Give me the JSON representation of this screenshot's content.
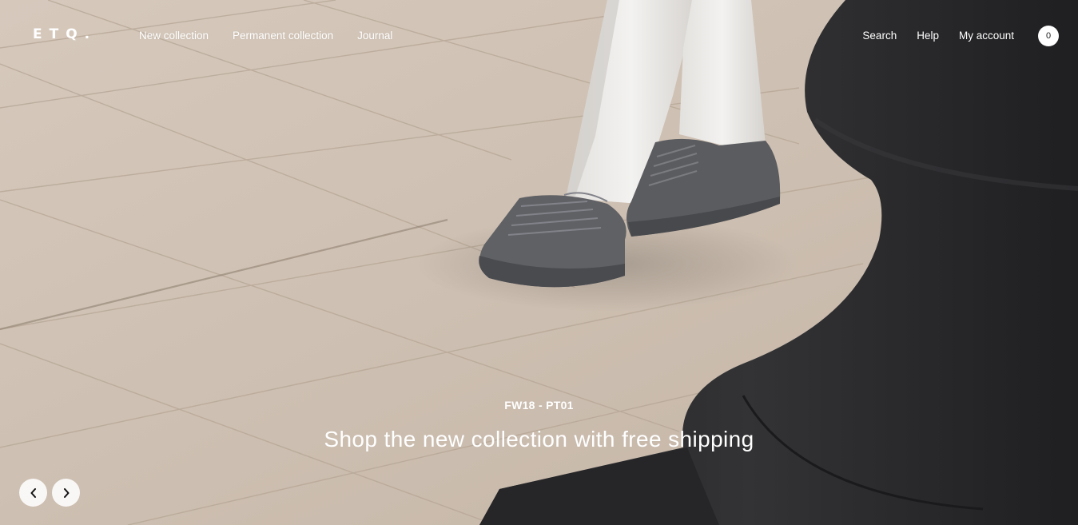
{
  "header": {
    "logo": "ETQ.",
    "nav_left": [
      {
        "label": "New collection"
      },
      {
        "label": "Permanent collection"
      },
      {
        "label": "Journal"
      }
    ],
    "nav_right": [
      {
        "label": "Search"
      },
      {
        "label": "Help"
      },
      {
        "label": "My account"
      }
    ],
    "cart_count": "0"
  },
  "hero": {
    "eyebrow": "FW18 - PT01",
    "headline": "Shop the new collection with free shipping",
    "image_icon": "hero-photo-sneakers-on-stone-plaza"
  },
  "slider": {
    "prev_icon": "chevron-left-icon",
    "next_icon": "chevron-right-icon"
  },
  "colors": {
    "text_on_image": "#ffffff",
    "stone_floor": "#d2c4b6",
    "sculpture": "#2b2b2d",
    "sneaker": "#5e5f63"
  }
}
